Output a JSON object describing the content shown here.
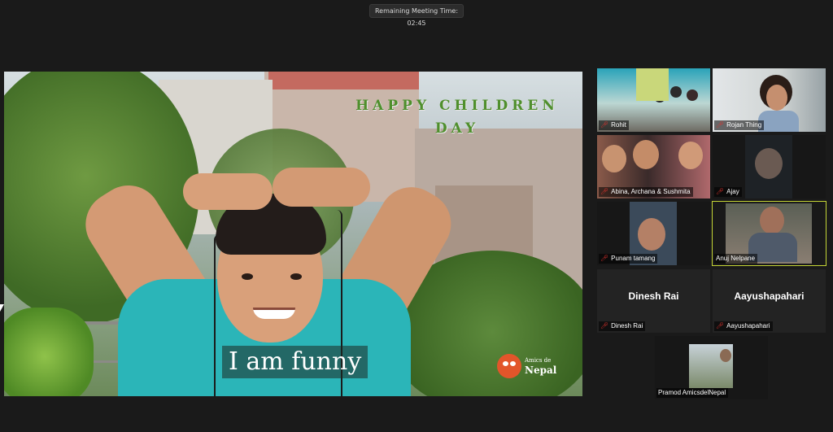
{
  "meeting": {
    "timer_text": "Remaining Meeting Time: 02:45"
  },
  "shared_video": {
    "headline": "HAPPY CHILDREN DAY",
    "caption": "I am funny",
    "brand_small": "Amics de",
    "brand_big": "Nepal"
  },
  "participants": [
    {
      "name": "Rohit",
      "muted": true
    },
    {
      "name": "Rojan Thing",
      "muted": true
    },
    {
      "name": "Abina, Archana & Sushmita",
      "muted": true
    },
    {
      "name": "Ajay",
      "muted": true
    },
    {
      "name": "Punam tamang",
      "muted": true
    },
    {
      "name": "Anuj Nelpane",
      "muted": false,
      "active_speaker": true
    },
    {
      "name": "Dinesh Rai",
      "display_label": "Dinesh Rai",
      "muted": true,
      "video_off": true
    },
    {
      "name": "Aayushapahari",
      "display_label": "Aayushapahari",
      "muted": true,
      "video_off": true
    },
    {
      "name": "Pramod AmicsdelNepal",
      "muted": false
    }
  ],
  "colors": {
    "active_border": "#c5d536",
    "muted_icon": "#e0322d",
    "background": "#1a1a1a"
  },
  "icons": {
    "muted": "microphone-muted-icon",
    "cursor": "mouse-cursor-icon"
  }
}
